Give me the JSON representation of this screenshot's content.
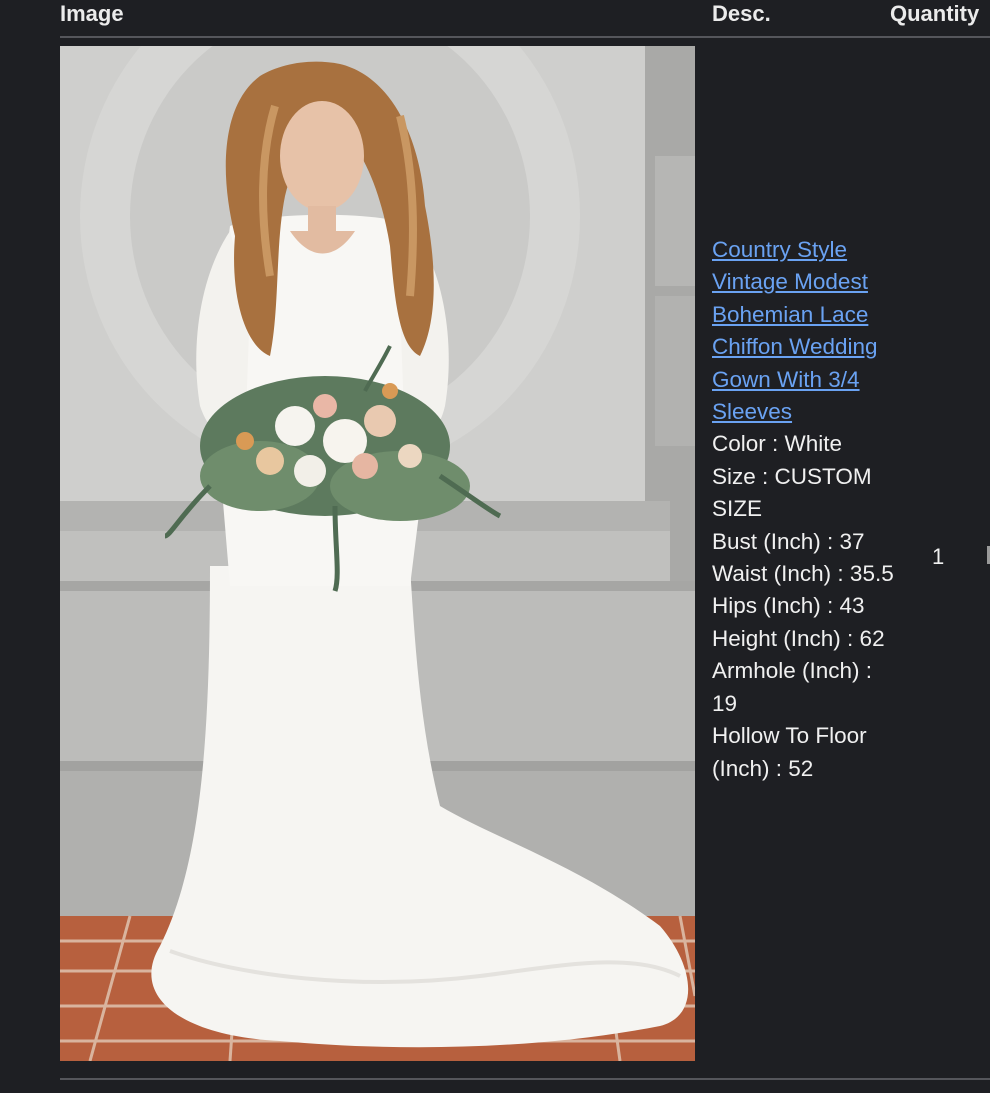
{
  "table": {
    "headers": {
      "image": "Image",
      "desc": "Desc.",
      "quantity": "Quantity"
    }
  },
  "item": {
    "title": "Country Style Vintage Modest Bohemian Lace Chiffon Wedding Gown With 3/4 Sleeves",
    "attributes": [
      "Color : White",
      "Size : CUSTOM SIZE",
      "Bust (Inch) : 37",
      "Waist (Inch) : 35.5",
      "Hips (Inch) : 43",
      "Height (Inch) : 62",
      "Armhole (Inch) : 19",
      "Hollow To Floor (Inch) : 52"
    ],
    "quantity": "1"
  },
  "colors": {
    "background": "#1e1f23",
    "link": "#6aa2f2",
    "text": "#f0f0f0"
  }
}
